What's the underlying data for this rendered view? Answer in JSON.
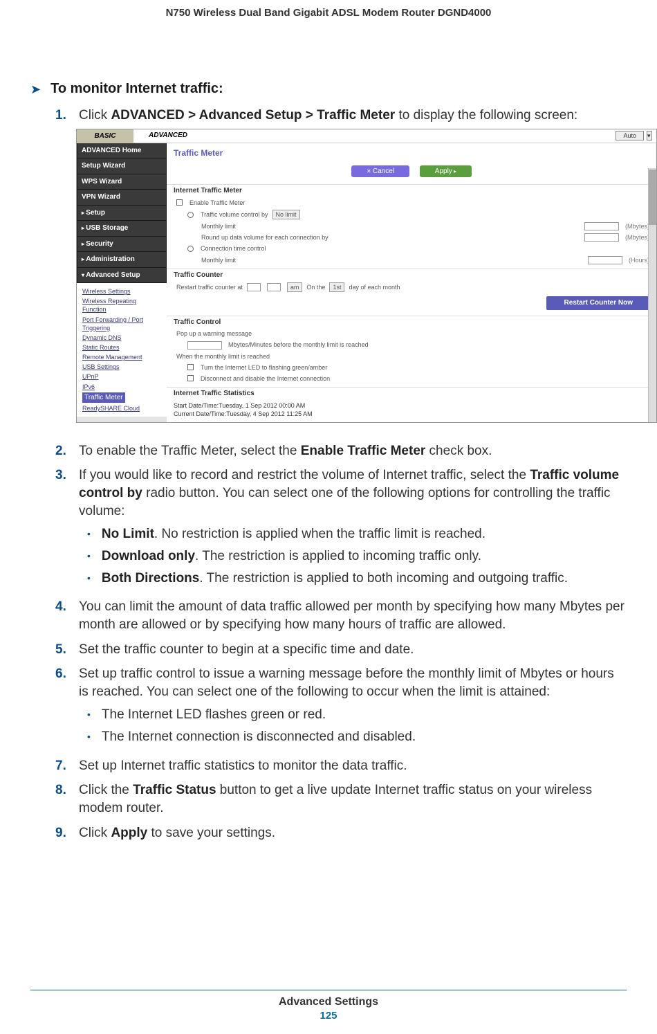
{
  "header": {
    "title": "N750 Wireless Dual Band Gigabit ADSL Modem Router DGND4000"
  },
  "section": {
    "title": "To monitor Internet traffic:"
  },
  "steps": {
    "s1": {
      "n": "1.",
      "before": "Click ",
      "bold": "ADVANCED > Advanced Setup > Traffic Meter",
      "after": " to display the following screen:"
    },
    "s2": {
      "n": "2.",
      "before": "To enable the Traffic Meter, select the ",
      "bold": "Enable Traffic Meter",
      "after": " check box."
    },
    "s3": {
      "n": "3.",
      "before": "If you would like to record and restrict the volume of Internet traffic, select the ",
      "bold": "Traffic volume control by",
      "after": " radio button. You can select one of the following options for controlling the traffic volume:"
    },
    "s3a": {
      "bold": "No Limit",
      "text": ". No restriction is applied when the traffic limit is reached."
    },
    "s3b": {
      "bold": "Download only",
      "text": ". The restriction is applied to incoming traffic only."
    },
    "s3c": {
      "bold": "Both Directions",
      "text": ". The restriction is applied to both incoming and outgoing traffic."
    },
    "s4": {
      "n": "4.",
      "text": "You can limit the amount of data traffic allowed per month by specifying how many Mbytes per month are allowed or by specifying how many hours of traffic are allowed."
    },
    "s5": {
      "n": "5.",
      "text": "Set the traffic counter to begin at a specific time and date."
    },
    "s6": {
      "n": "6.",
      "text": "Set up traffic control to issue a warning message before the monthly limit of Mbytes or hours is reached. You can select one of the following to occur when the limit is attained:"
    },
    "s6a": {
      "text": "The Internet LED flashes green or red."
    },
    "s6b": {
      "text": "The Internet connection is disconnected and disabled."
    },
    "s7": {
      "n": "7.",
      "text": "Set up Internet traffic statistics to monitor the data traffic."
    },
    "s8": {
      "n": "8.",
      "before": "Click the ",
      "bold": "Traffic Status",
      "after": " button to get a live update Internet traffic status on your wireless modem router."
    },
    "s9": {
      "n": "9.",
      "before": "Click ",
      "bold": "Apply",
      "after": " to save your settings."
    }
  },
  "shot": {
    "tabs": {
      "basic": "BASIC",
      "advanced": "ADVANCED",
      "auto": "Auto"
    },
    "nav": {
      "home": "ADVANCED Home",
      "wizard": "Setup Wizard",
      "wps": "WPS Wizard",
      "vpn": "VPN Wizard",
      "setup": "Setup",
      "usb": "USB Storage",
      "sec": "Security",
      "admin": "Administration",
      "advsetup": "Advanced Setup"
    },
    "subnav": {
      "a": "Wireless Settings",
      "b": "Wireless Repeating Function",
      "c": "Port Forwarding / Port Triggering",
      "d": "Dynamic DNS",
      "e": "Static Routes",
      "f": "Remote Management",
      "g": "USB Settings",
      "h": "UPnP",
      "i": "IPv6",
      "j": "Traffic Meter",
      "k": "ReadySHARE Cloud"
    },
    "pane": {
      "title": "Traffic Meter",
      "cancel": "Cancel",
      "apply": "Apply",
      "sec1": "Internet Traffic Meter",
      "enable": "Enable Traffic Meter",
      "volctl": "Traffic volume control by",
      "volsel": "No limit",
      "mlimit": "Monthly limit",
      "mbytes": "(Mbytes)",
      "round": "Round up data volume for each connection by",
      "mbytes2": "(Mbytes)",
      "connctl": "Connection time control",
      "mlimit2": "Monthly limit",
      "hours": "(Hours)",
      "sec2": "Traffic Counter",
      "restart_at": "Restart traffic counter at",
      "am": "am",
      "onthe": "On the",
      "first": "1st",
      "dayof": "day of each month",
      "restart_btn": "Restart Counter Now",
      "sec3": "Traffic Control",
      "popup": "Pop up a warning message",
      "before": "Mbytes/Minutes before the monthly limit is reached",
      "when": "When the monthly limit is reached",
      "led": "Turn the Internet LED to flashing green/amber",
      "disc": "Disconnect and disable the Internet connection",
      "sec4": "Internet Traffic Statistics",
      "start": "Start Date/Time:Tuesday, 1 Sep 2012 00:00 AM",
      "curr": "Current Date/Time:Tuesday, 4 Sep 2012 11:25 AM"
    }
  },
  "footer": {
    "section": "Advanced Settings",
    "page": "125"
  }
}
